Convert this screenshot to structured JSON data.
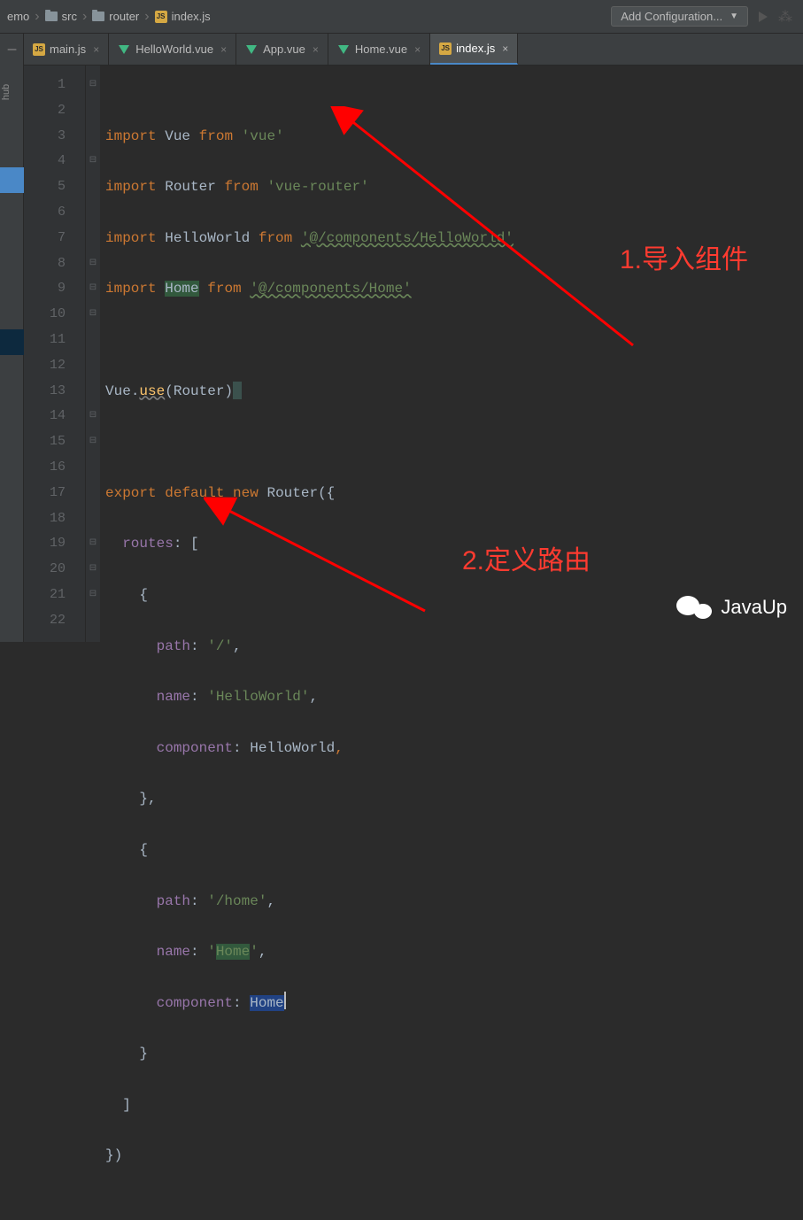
{
  "breadcrumb": {
    "item0": "emo",
    "item1": "src",
    "item2": "router",
    "item3": "index.js"
  },
  "toolbar": {
    "config_label": "Add Configuration..."
  },
  "sidebar": {
    "label0": "hub"
  },
  "tabs": {
    "t0": "main.js",
    "t1": "HelloWorld.vue",
    "t2": "App.vue",
    "t3": "Home.vue",
    "t4": "index.js"
  },
  "lines": {
    "l1": "1",
    "l2": "2",
    "l3": "3",
    "l4": "4",
    "l5": "5",
    "l6": "6",
    "l7": "7",
    "l8": "8",
    "l9": "9",
    "l10": "10",
    "l11": "11",
    "l12": "12",
    "l13": "13",
    "l14": "14",
    "l15": "15",
    "l16": "16",
    "l17": "17",
    "l18": "18",
    "l19": "19",
    "l20": "20",
    "l21": "21",
    "l22": "22"
  },
  "code": {
    "import": "import",
    "from": "from",
    "Vue": "Vue",
    "Router": "Router",
    "HelloWorld": "HelloWorld",
    "Home": "Home",
    "vue_str": "'vue'",
    "vuerouter_str": "'vue-router'",
    "hw_path": "'@/components/HelloWorld'",
    "home_path": "'@/components/Home'",
    "use": "use",
    "router_p1": "(Router)",
    "export": "export",
    "default": "default",
    "new": "new",
    "router_open": "({",
    "routes": "routes",
    "colon_bracket": ": [",
    "brace_open": "{",
    "path": "path",
    "slash": "'/'",
    "name": "name",
    "hw_name": "'HelloWorld'",
    "component": "component",
    "brace_close_c": "},",
    "brace_close": "}",
    "home_route": "'/home'",
    "home_name_q1": "'",
    "home_name_q2": "'",
    "close_bracket": "]",
    "close_paren": "})",
    "comma": ",",
    "dot": "."
  },
  "annotations": {
    "a1": "1.导入组件",
    "a2": "2.定义路由"
  },
  "watermark": {
    "text": "JavaUp"
  }
}
